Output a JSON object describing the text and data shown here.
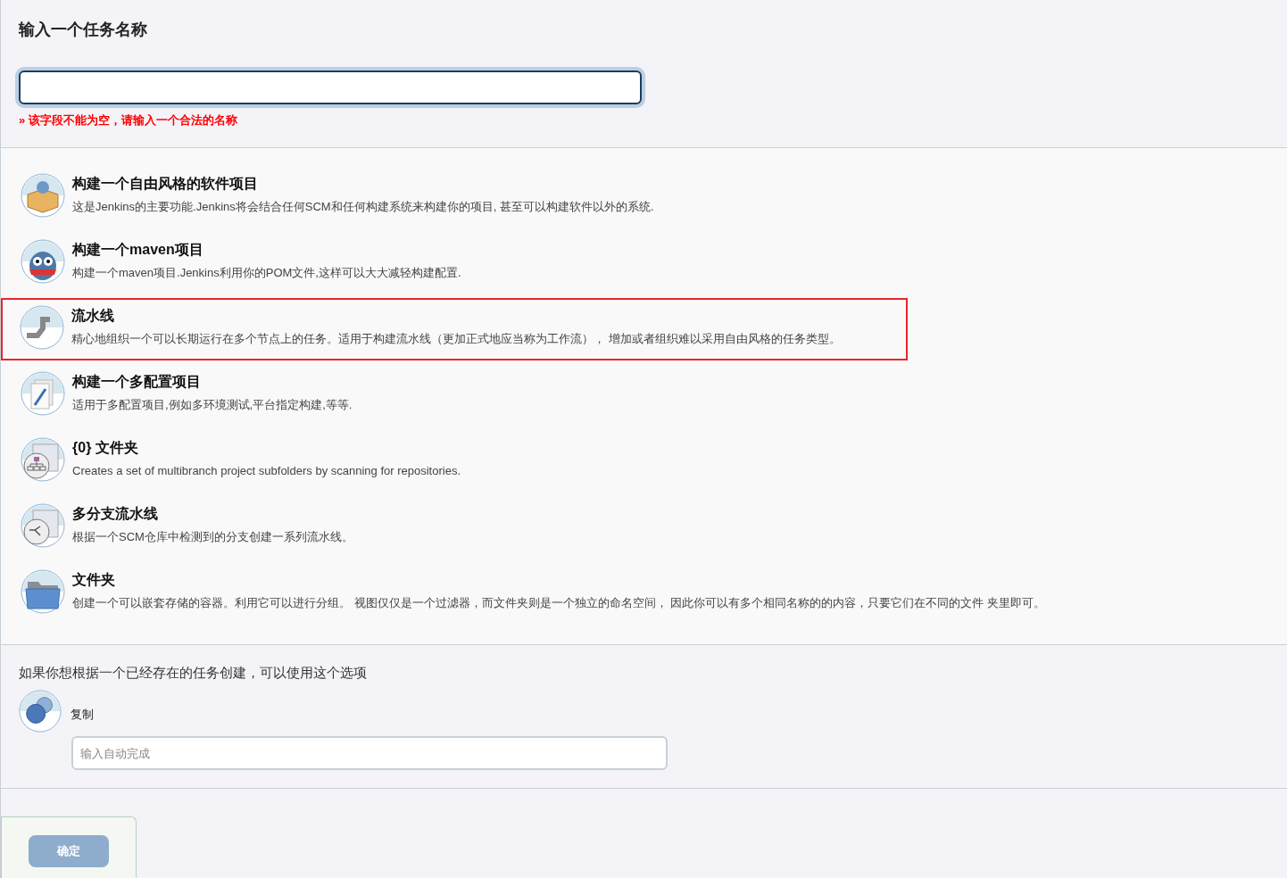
{
  "name_section": {
    "heading": "输入一个任务名称",
    "error": "» 该字段不能为空，请输入一个合法的名称"
  },
  "item_types": [
    {
      "kind": "freestyle",
      "title": "构建一个自由风格的软件项目",
      "description": "这是Jenkins的主要功能.Jenkins将会结合任何SCM和任何构建系统来构建你的项目, 甚至可以构建软件以外的系统.",
      "highlighted": false
    },
    {
      "kind": "maven",
      "title": "构建一个maven项目",
      "description": "构建一个maven项目.Jenkins利用你的POM文件,这样可以大大减轻构建配置.",
      "highlighted": false
    },
    {
      "kind": "pipeline",
      "title": "流水线",
      "description": "精心地组织一个可以长期运行在多个节点上的任务。适用于构建流水线（更加正式地应当称为工作流）， 增加或者组织难以采用自由风格的任务类型。",
      "highlighted": true
    },
    {
      "kind": "matrix",
      "title": "构建一个多配置项目",
      "description": "适用于多配置项目,例如多环境测试,平台指定构建,等等.",
      "highlighted": false
    },
    {
      "kind": "orgfolder",
      "title": "{0} 文件夹",
      "description": "Creates a set of multibranch project subfolders by scanning for repositories.",
      "highlighted": false
    },
    {
      "kind": "multibranch",
      "title": "多分支流水线",
      "description": "根据一个SCM仓库中检测到的分支创建一系列流水线。",
      "highlighted": false
    },
    {
      "kind": "folder",
      "title": "文件夹",
      "description": "创建一个可以嵌套存储的容器。利用它可以进行分组。 视图仅仅是一个过滤器，而文件夹则是一个独立的命名空间， 因此你可以有多个相同名称的的内容，只要它们在不同的文件 夹里即可。",
      "highlighted": false
    }
  ],
  "copy_section": {
    "hint": "如果你想根据一个已经存在的任务创建，可以使用这个选项",
    "label": "复制",
    "placeholder": "输入自动完成"
  },
  "ok_button": {
    "label": "确定",
    "disabled": true
  }
}
